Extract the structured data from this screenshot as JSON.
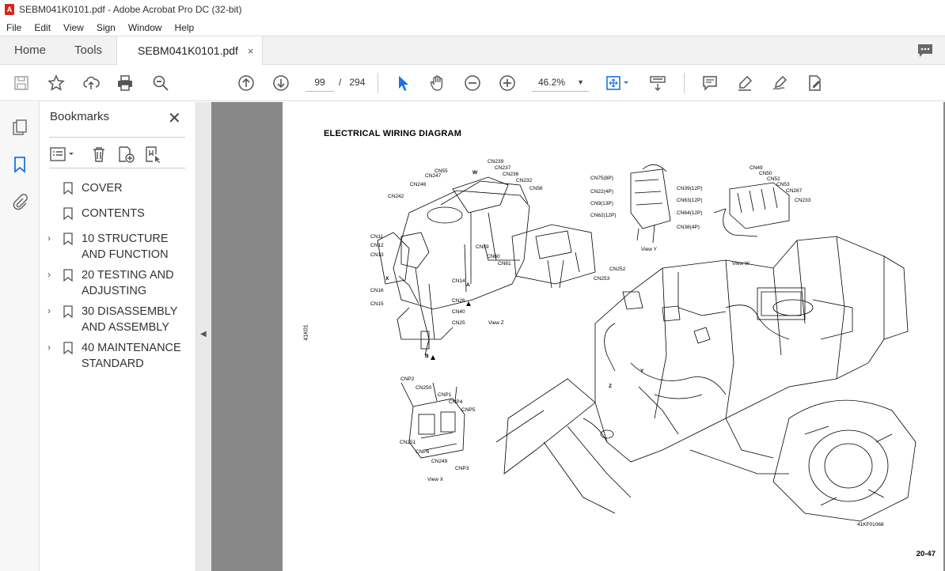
{
  "window": {
    "title": "SEBM041K0101.pdf - Adobe Acrobat Pro DC (32-bit)",
    "icon_glyph": "A"
  },
  "menu": [
    "File",
    "Edit",
    "View",
    "Sign",
    "Window",
    "Help"
  ],
  "tabs": {
    "home": "Home",
    "tools": "Tools",
    "document": "SEBM041K0101.pdf",
    "close": "×"
  },
  "toolbar": {
    "current_page": "99",
    "page_sep": "/",
    "total_pages": "294",
    "zoom": "46.2%",
    "zoom_caret": "▼"
  },
  "bookmarks": {
    "title": "Bookmarks",
    "close": "✕",
    "items": [
      {
        "label": "COVER",
        "expandable": false
      },
      {
        "label": "CONTENTS",
        "expandable": false
      },
      {
        "label": "10 STRUCTURE AND FUNCTION",
        "expandable": true
      },
      {
        "label": "20 TESTING AND ADJUSTING",
        "expandable": true
      },
      {
        "label": "30 DISASSEMBLY AND ASSEMBLY",
        "expandable": true
      },
      {
        "label": "40 MAINTENANCE STANDARD",
        "expandable": true
      }
    ],
    "chevron": "›"
  },
  "collapse_arrow": "◀",
  "document": {
    "title": "ELECTRICAL  WIRING  DIAGRAM",
    "page_number": "20-47",
    "side_code": "41K01",
    "figure_code": "41KF01068",
    "labels": {
      "view_z": "View Z",
      "view_y": "View Y",
      "view_w": "View W",
      "view_x": "View X",
      "cn239": "CN239",
      "cn237": "CN237",
      "cn236": "CN236",
      "cn55": "CN55",
      "cn247": "CN247",
      "cn232": "CN232",
      "cn246": "CN246",
      "cn56": "CN56",
      "cn242": "CN242",
      "w": "W",
      "cn11": "CN11",
      "cn12": "CN12",
      "cn13": "CN13",
      "cn59": "CN59",
      "cn60": "CN60",
      "cn61": "CN61",
      "x": "X",
      "cn16": "CN16",
      "cn14": "CN14",
      "a": "A",
      "cn15": "CN15",
      "cn26": "CN26",
      "cn40": "CN40",
      "cn25": "CN25",
      "b": "B",
      "cn75": "CN75(8P)",
      "cn22": "CN22(4P)",
      "cn39": "CN39(12P)",
      "cn9": "CN9(13P)",
      "cn63": "CN63(12P)",
      "cn62": "CN62(12P)",
      "cn64": "CN64(12P)",
      "cn38": "CN38(4P)",
      "cn252": "CN252",
      "cn253": "CN253",
      "cn49": "CN49",
      "cn50": "CN50",
      "cn52": "CN52",
      "cn53": "CN53",
      "cn267": "CN267",
      "cn233": "CN233",
      "cnp2": "CNP2",
      "cn250": "CN250",
      "cnp1": "CNP1",
      "cnp4": "CNP4",
      "cnp5": "CNP5",
      "cn251": "CN251",
      "cnp6": "CNP6",
      "cn249": "CN249",
      "cnp3": "CNP3",
      "y": "Y",
      "z": "Z"
    }
  }
}
